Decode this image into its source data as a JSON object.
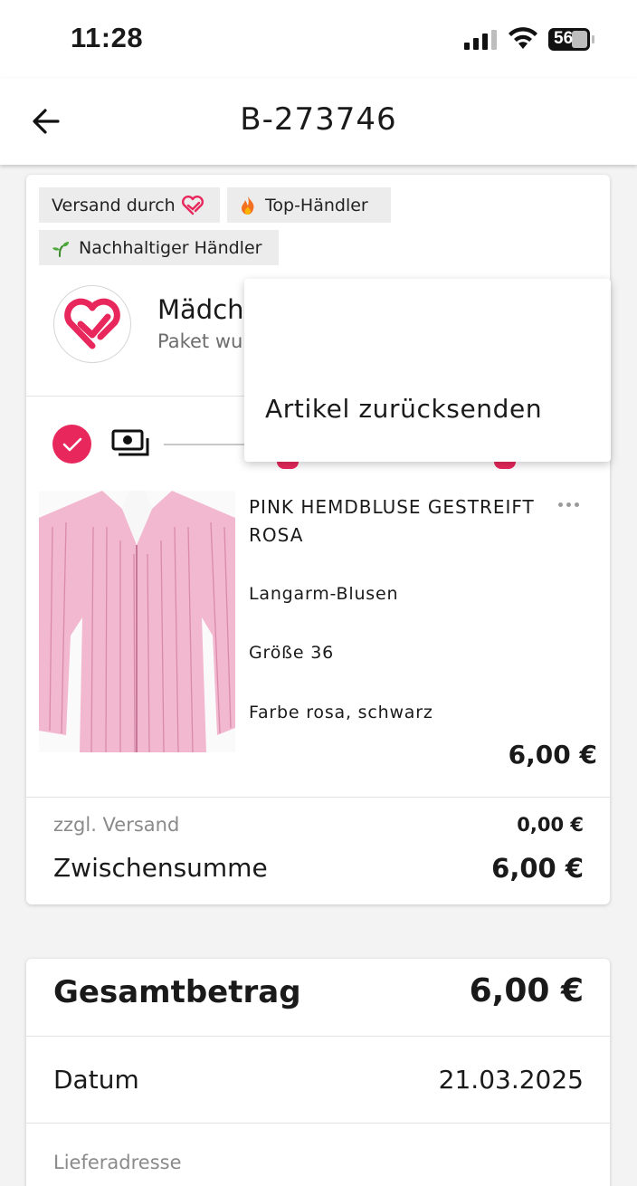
{
  "status_bar": {
    "time": "11:28",
    "battery": "56"
  },
  "header": {
    "title": "B-273746"
  },
  "seller": {
    "tags": [
      {
        "label": "Versand durch"
      },
      {
        "label": "Top-Händler"
      },
      {
        "label": "Nachhaltiger Händler"
      }
    ],
    "name": "Mädch",
    "status": "Paket wu"
  },
  "menu": {
    "items": [
      {
        "label": "Artikel zurücksenden"
      }
    ]
  },
  "product": {
    "name": "PINK HEMDBLUSE GESTREIFT ROSA",
    "category": "Langarm-Blusen",
    "size": "Größe 36",
    "color": "Farbe rosa, schwarz",
    "price": "6,00 €"
  },
  "order_totals": {
    "shipping_label": "zzgl. Versand",
    "shipping_value": "0,00 €",
    "subtotal_label": "Zwischensumme",
    "subtotal_value": "6,00 €"
  },
  "summary": {
    "total_label": "Gesamtbetrag",
    "total_value": "6,00 €",
    "date_label": "Datum",
    "date_value": "21.03.2025",
    "address_label": "Lieferadresse"
  },
  "colors": {
    "accent": "#e8285c",
    "tag_bg": "#ececec"
  }
}
